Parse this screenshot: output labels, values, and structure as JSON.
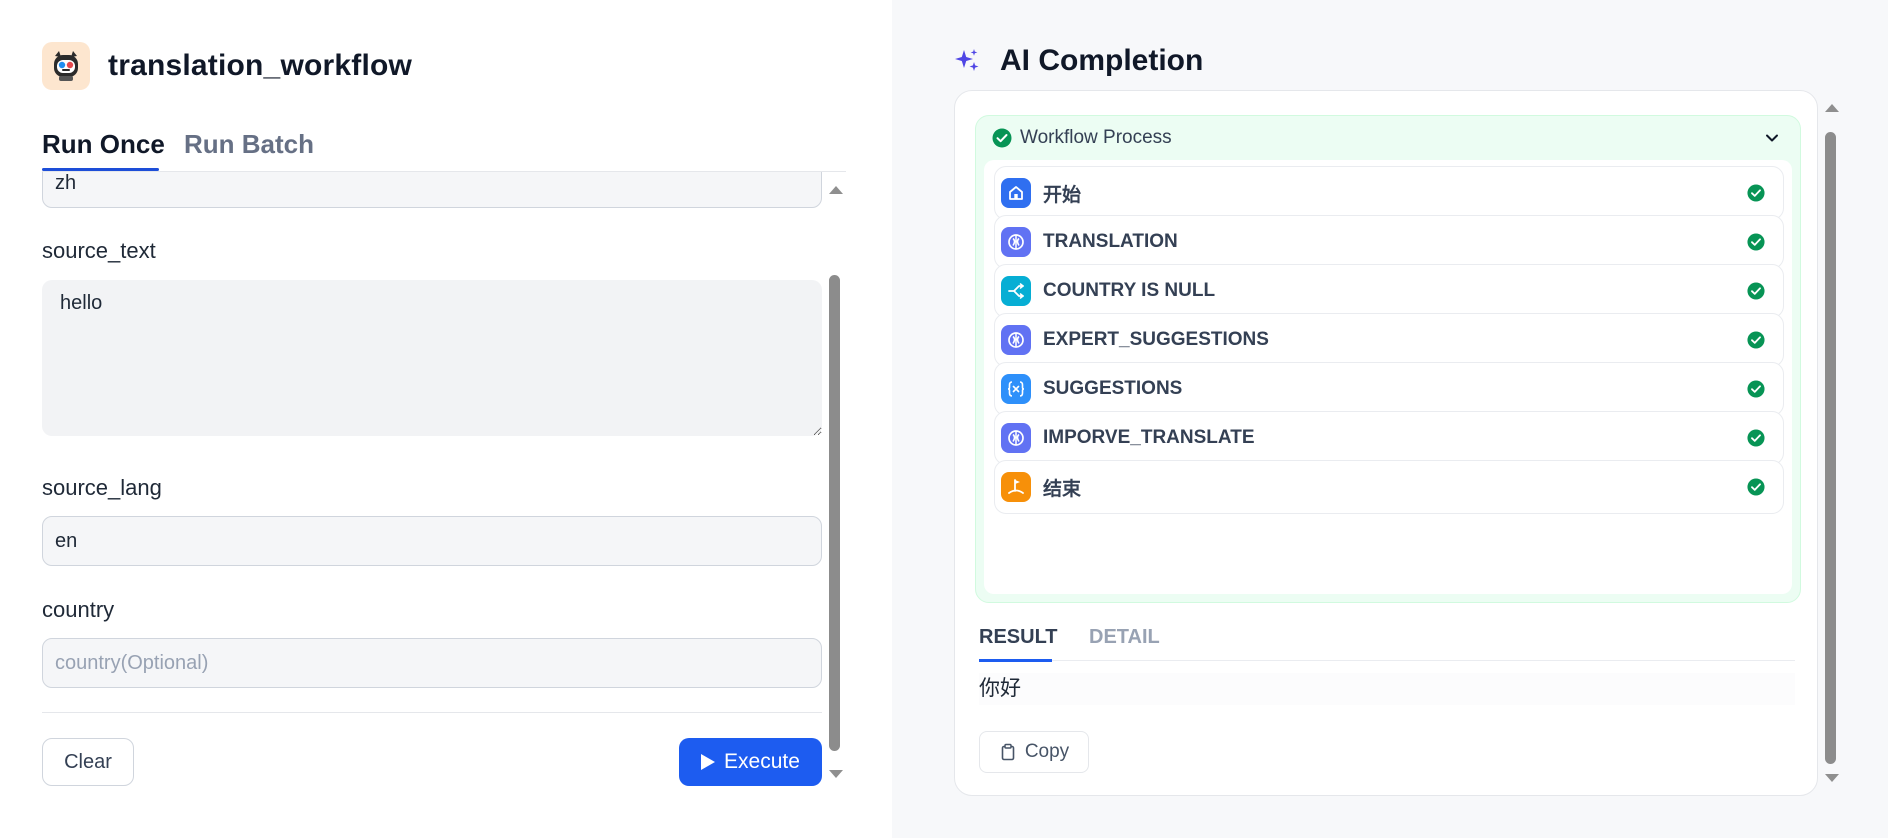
{
  "app": {
    "title": "translation_workflow"
  },
  "tabs": {
    "run_once": "Run Once",
    "run_batch": "Run Batch"
  },
  "form": {
    "target_lang_value": "zh",
    "source_text": {
      "label": "source_text",
      "value": "hello"
    },
    "source_lang": {
      "label": "source_lang",
      "value": "en"
    },
    "country": {
      "label": "country",
      "placeholder": "country(Optional)",
      "value": ""
    }
  },
  "buttons": {
    "clear": "Clear",
    "execute": "Execute"
  },
  "completion": {
    "title": "AI Completion",
    "workflow_process": "Workflow Process",
    "nodes": [
      {
        "label": "开始",
        "icon": "home-icon",
        "color": "#2f6ff0"
      },
      {
        "label": "TRANSLATION",
        "icon": "llm-brain-icon",
        "color": "#6172f3"
      },
      {
        "label": "COUNTRY IS NULL",
        "icon": "branch-icon",
        "color": "#06aed4"
      },
      {
        "label": "EXPERT_SUGGESTIONS",
        "icon": "llm-brain-icon",
        "color": "#6172f3"
      },
      {
        "label": "SUGGESTIONS",
        "icon": "variable-icon",
        "color": "#2e90fa"
      },
      {
        "label": "IMPORVE_TRANSLATE",
        "icon": "llm-brain-icon",
        "color": "#6172f3"
      },
      {
        "label": "结束",
        "icon": "end-flag-icon",
        "color": "#f79009"
      }
    ],
    "result_tab": "RESULT",
    "detail_tab": "DETAIL",
    "result_text": "你好",
    "copy_label": "Copy"
  },
  "colors": {
    "accent": "#1d5cf0",
    "success": "#12b76a"
  }
}
